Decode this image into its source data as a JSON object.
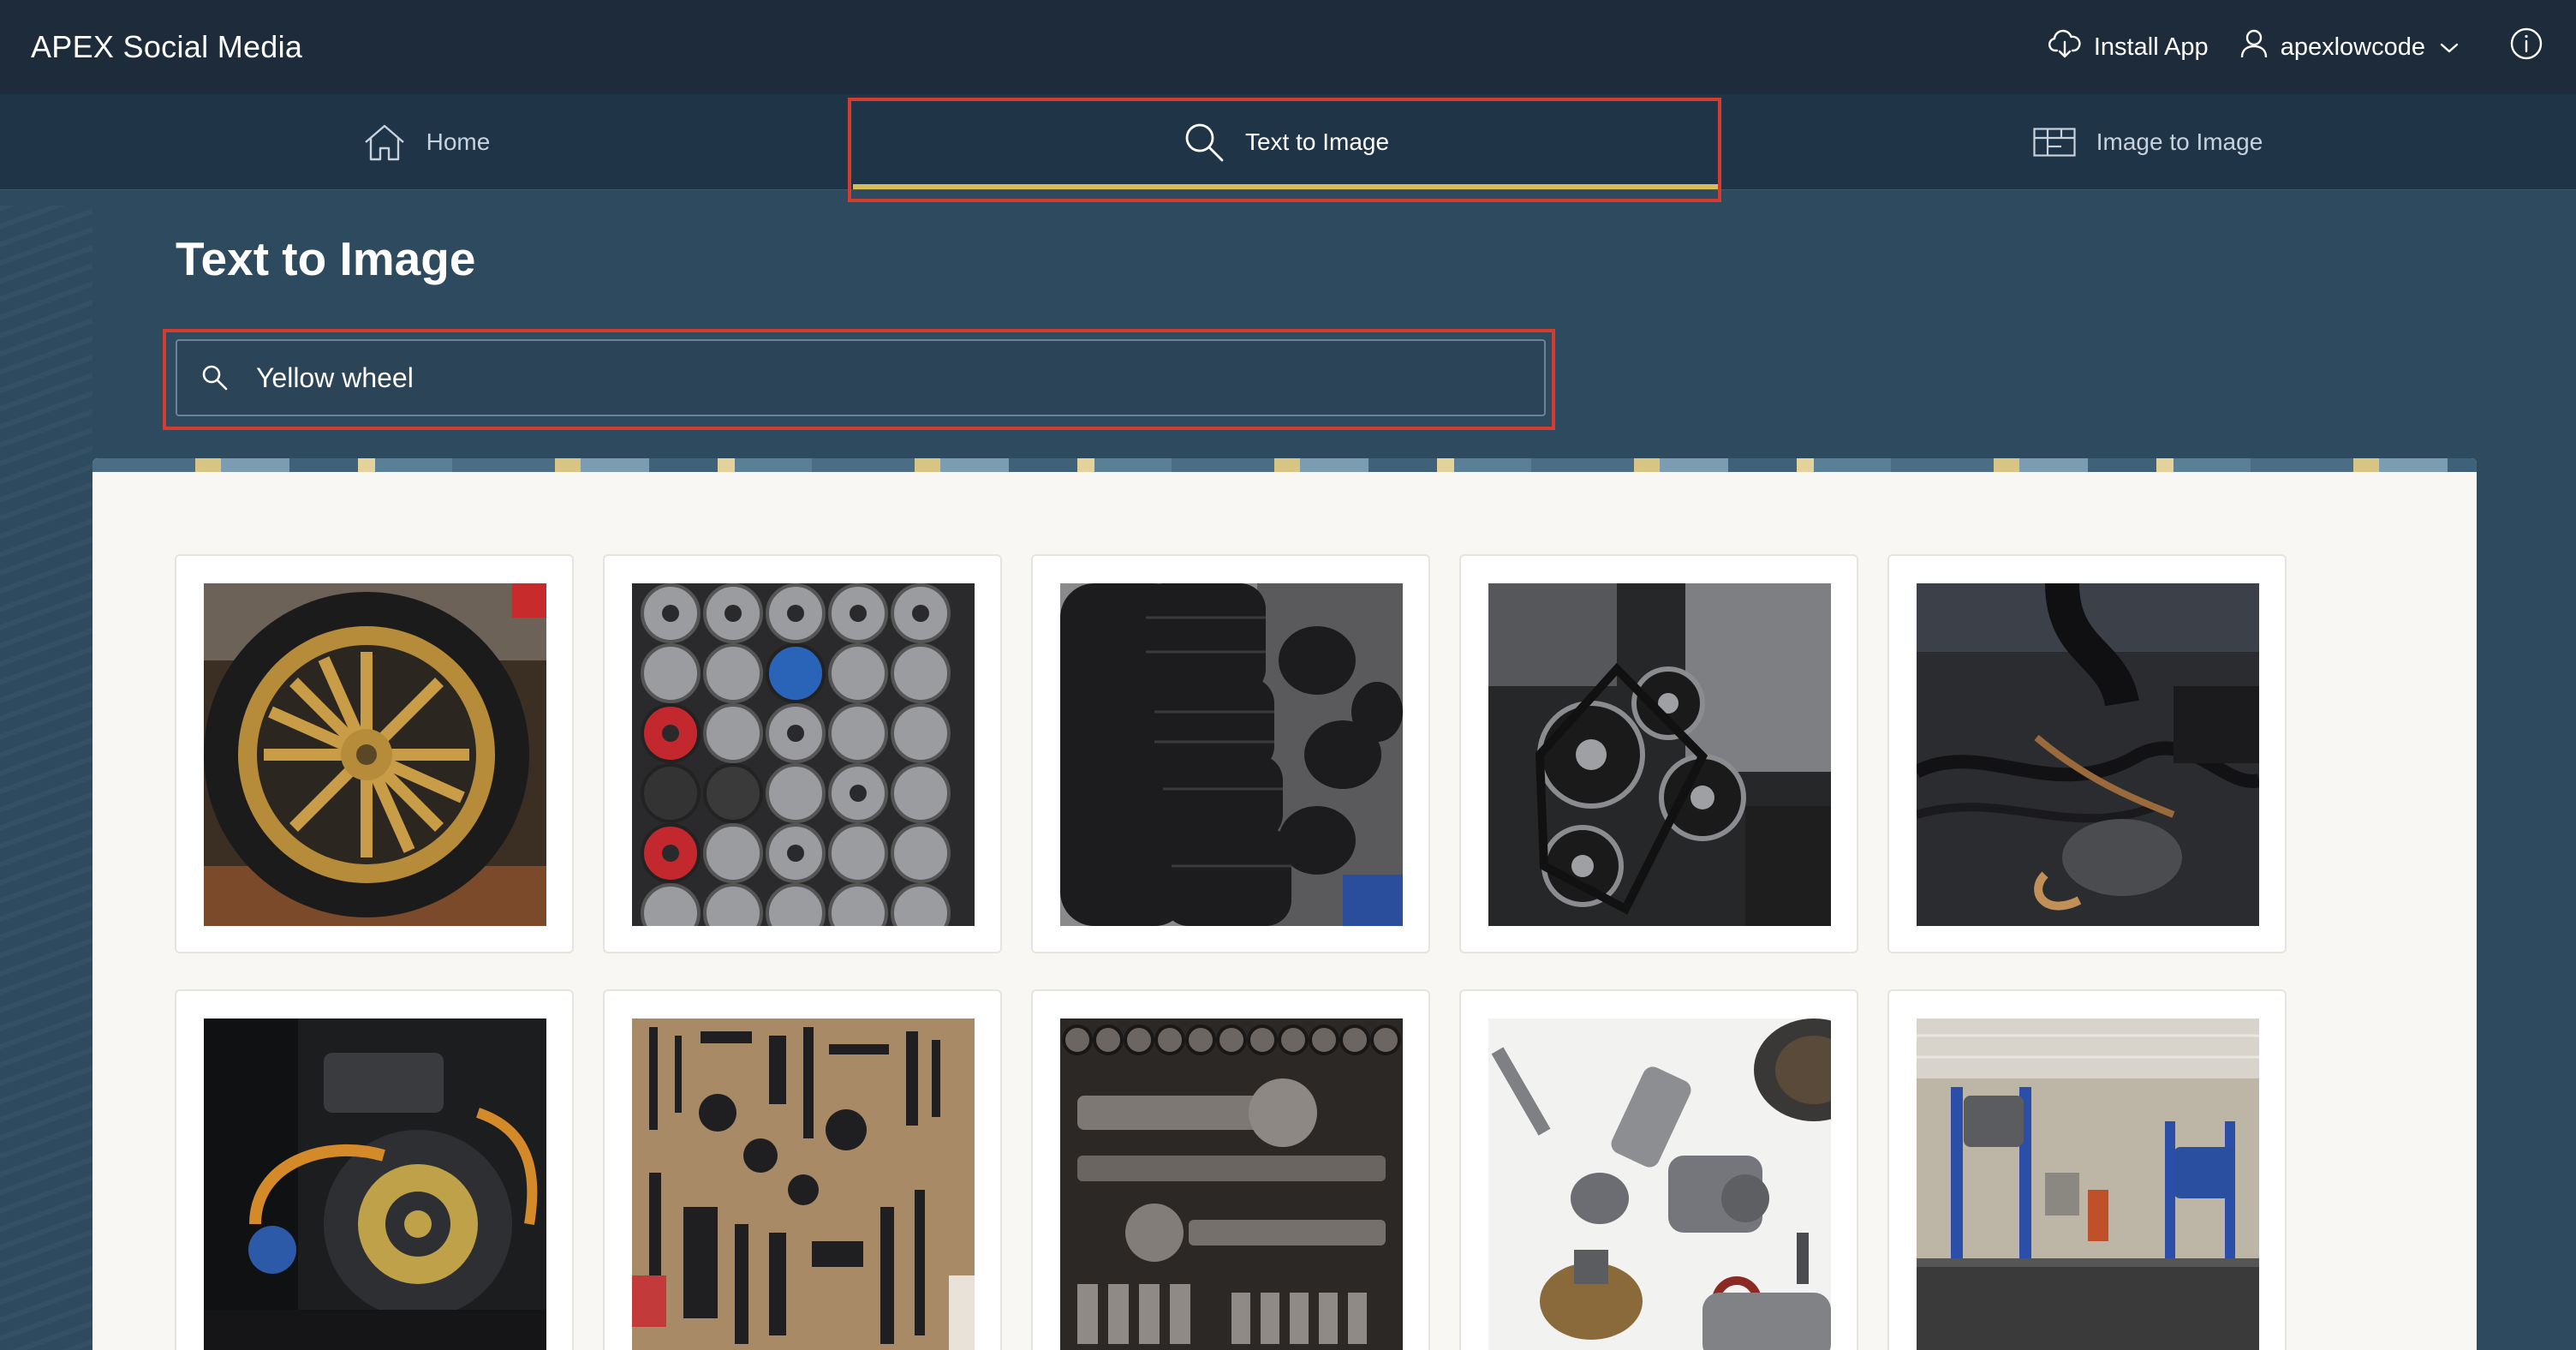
{
  "header": {
    "app_title": "APEX Social Media",
    "install_label": "Install App",
    "user_label": "apexlowcode",
    "icons": {
      "install": "cloud-download-icon",
      "user": "user-icon",
      "chevron": "chevron-down-icon",
      "info": "info-icon"
    }
  },
  "tabs": [
    {
      "label": "Home",
      "icon": "home-icon",
      "active": false
    },
    {
      "label": "Text to Image",
      "icon": "search-icon",
      "active": true
    },
    {
      "label": "Image to Image",
      "icon": "grid-icon",
      "active": false
    }
  ],
  "page": {
    "title": "Text to Image"
  },
  "search": {
    "value": "Yellow wheel",
    "icon": "search-icon"
  },
  "gallery": {
    "images": [
      {
        "subject": "yellow wheel"
      },
      {
        "subject": "wheel rims"
      },
      {
        "subject": "stacked tires"
      },
      {
        "subject": "engine belts"
      },
      {
        "subject": "engine hoses"
      },
      {
        "subject": "engine"
      },
      {
        "subject": "tool wall"
      },
      {
        "subject": "socket set"
      },
      {
        "subject": "metal parts"
      },
      {
        "subject": "garage"
      }
    ]
  },
  "colors": {
    "topbar": "#1d2b3b",
    "tabbar": "#1f3447",
    "background": "#2e4a5f",
    "active_tab_underline": "#d7bd5c",
    "highlight_box": "#d43c2f"
  }
}
